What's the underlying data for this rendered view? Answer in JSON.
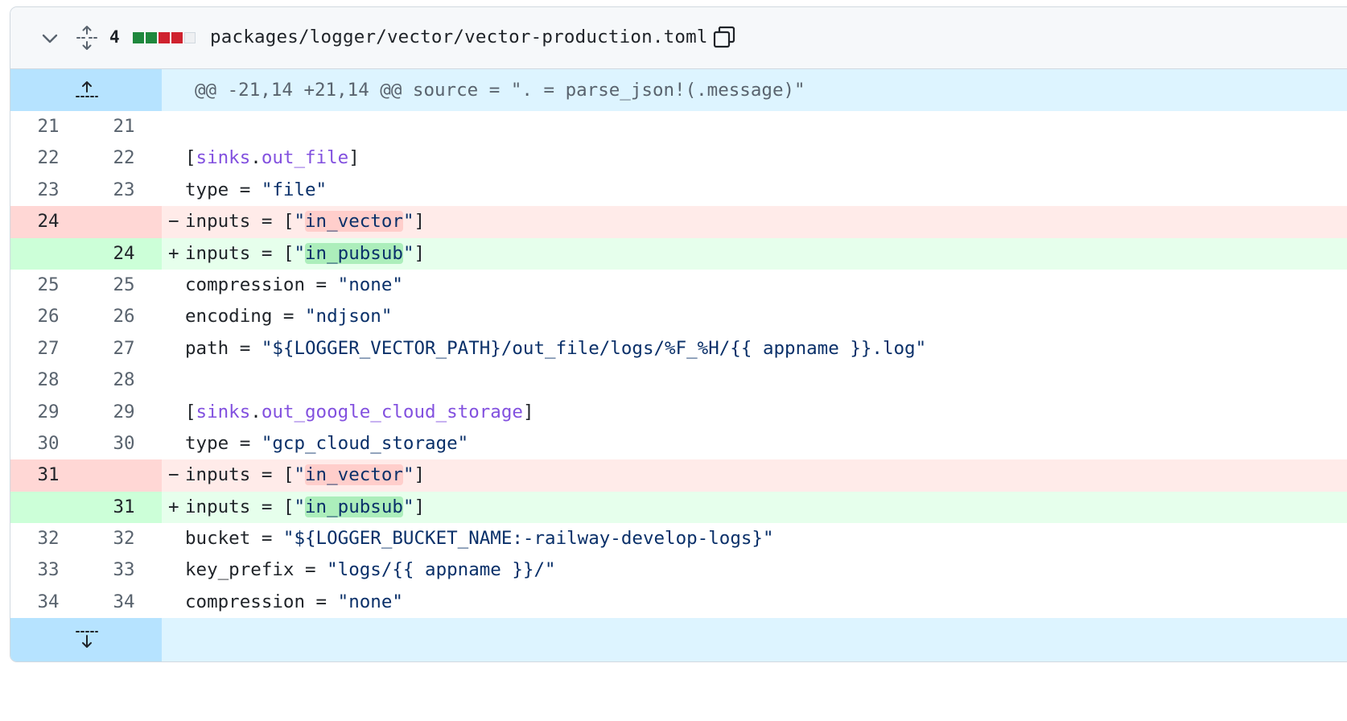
{
  "file": {
    "change_count": "4",
    "path": "packages/logger/vector/vector-production.toml",
    "diffstat": [
      "add",
      "add",
      "del",
      "del",
      "neutral"
    ],
    "colors": {
      "add": "#1f883d",
      "del": "#cf222e",
      "neutral": "#e6e8ea"
    }
  },
  "hunk": {
    "header": "@@ -21,14 +21,14 @@ source = \". = parse_json!(.message)\""
  },
  "lines": [
    {
      "type": "ctx",
      "old": "21",
      "new": "21",
      "marker": " ",
      "text": ""
    },
    {
      "type": "ctx",
      "old": "22",
      "new": "22",
      "marker": " ",
      "text": "[sinks.out_file]"
    },
    {
      "type": "ctx",
      "old": "23",
      "new": "23",
      "marker": " ",
      "text": "type = \"file\""
    },
    {
      "type": "del",
      "old": "24",
      "new": "",
      "marker": "-",
      "text": "inputs = [\"in_vector\"]"
    },
    {
      "type": "add",
      "old": "",
      "new": "24",
      "marker": "+",
      "text": "inputs = [\"in_pubsub\"]"
    },
    {
      "type": "ctx",
      "old": "25",
      "new": "25",
      "marker": " ",
      "text": "compression = \"none\""
    },
    {
      "type": "ctx",
      "old": "26",
      "new": "26",
      "marker": " ",
      "text": "encoding = \"ndjson\""
    },
    {
      "type": "ctx",
      "old": "27",
      "new": "27",
      "marker": " ",
      "text": "path = \"${LOGGER_VECTOR_PATH}/out_file/logs/%F_%H/{{ appname }}.log\""
    },
    {
      "type": "ctx",
      "old": "28",
      "new": "28",
      "marker": " ",
      "text": ""
    },
    {
      "type": "ctx",
      "old": "29",
      "new": "29",
      "marker": " ",
      "text": "[sinks.out_google_cloud_storage]"
    },
    {
      "type": "ctx",
      "old": "30",
      "new": "30",
      "marker": " ",
      "text": "type = \"gcp_cloud_storage\""
    },
    {
      "type": "del",
      "old": "31",
      "new": "",
      "marker": "-",
      "text": "inputs = [\"in_vector\"]"
    },
    {
      "type": "add",
      "old": "",
      "new": "31",
      "marker": "+",
      "text": "inputs = [\"in_pubsub\"]"
    },
    {
      "type": "ctx",
      "old": "32",
      "new": "32",
      "marker": " ",
      "text": "bucket = \"${LOGGER_BUCKET_NAME:-railway-develop-logs}\""
    },
    {
      "type": "ctx",
      "old": "33",
      "new": "33",
      "marker": " ",
      "text": "key_prefix = \"logs/{{ appname }}/\""
    },
    {
      "type": "ctx",
      "old": "34",
      "new": "34",
      "marker": " ",
      "text": "compression = \"none\""
    }
  ],
  "icons": {
    "collapse": "chevron-down-icon",
    "expand_all": "unfold-icon",
    "copy": "copy-icon",
    "expand_up": "expand-up-icon",
    "expand_down": "expand-down-icon"
  }
}
